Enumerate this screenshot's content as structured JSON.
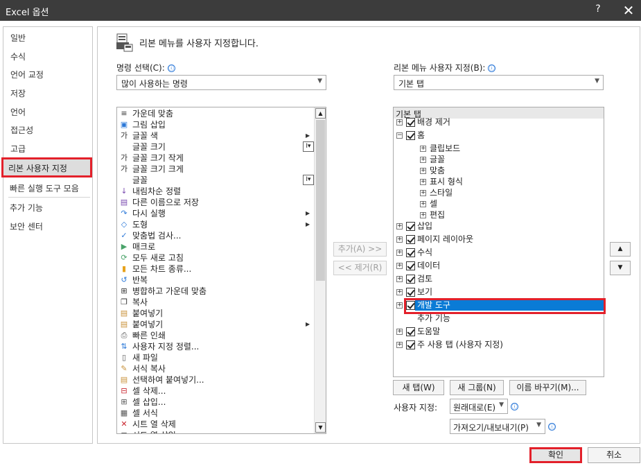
{
  "window": {
    "title": "Excel 옵션",
    "help": "?",
    "close": "✕"
  },
  "leftnav": {
    "items": [
      "일반",
      "수식",
      "언어 교정",
      "저장",
      "언어",
      "접근성",
      "고급",
      "리본 사용자 지정",
      "빠른 실행 도구 모음",
      "추가 기능",
      "보안 센터"
    ],
    "selected": "리본 사용자 지정"
  },
  "main": {
    "header": "리본 메뉴를 사용자 지정합니다.",
    "choose_label": "명령 선택(C):",
    "choose_value": "많이 사용하는 명령",
    "customize_label": "리본 메뉴 사용자 지정(B):",
    "customize_value": "기본 탭",
    "commands": [
      "가운데 맞춤",
      "그림 삽입",
      "글꼴 색",
      "글꼴 크기",
      "글꼴 크기 작게",
      "글꼴 크기 크게",
      "글꼴",
      "내림차순 정렬",
      "다른 이름으로 저장",
      "다시 실행",
      "도형",
      "맞춤법 검사...",
      "매크로",
      "모두 새로 고침",
      "모든 차트 종류...",
      "반복",
      "병합하고 가운데 맞춤",
      "복사",
      "붙여넣기",
      "붙여넣기",
      "빠른 인쇄",
      "사용자 지정 정렬...",
      "새 파일",
      "서식 복사",
      "선택하여 붙여넣기...",
      "셀 삭제...",
      "셀 삽입...",
      "셀 서식",
      "시트 열 삭제",
      "시트 열 삽입"
    ],
    "add_button": "추가(A) >>",
    "remove_button": "<< 제거(R)",
    "tree_header": "기본 탭",
    "tree": {
      "background_removal": "배경 제거",
      "home": "홈",
      "home_groups": [
        "클립보드",
        "글꼴",
        "맞춤",
        "표시 형식",
        "스타일",
        "셀",
        "편집"
      ],
      "tabs": [
        "삽입",
        "페이지 레이아웃",
        "수식",
        "데이터",
        "검토",
        "보기",
        "개발 도구",
        "추가 기능",
        "도움말",
        "주 사용 탭 (사용자 지정)"
      ]
    },
    "new_tab_button": "새 탭(W)",
    "new_group_button": "새 그룹(N)",
    "rename_button": "이름 바꾸기(M)...",
    "customizations_label": "사용자 지정:",
    "reset_value": "원래대로(E)",
    "import_export_value": "가져오기/내보내기(P)",
    "info_icon": "ⓘ"
  },
  "footer": {
    "ok": "확인",
    "cancel": "취소"
  },
  "colors": {
    "highlight": "#0a7bd6",
    "annotation_red": "#e3202a",
    "titlebar": "#3c3c3c"
  }
}
